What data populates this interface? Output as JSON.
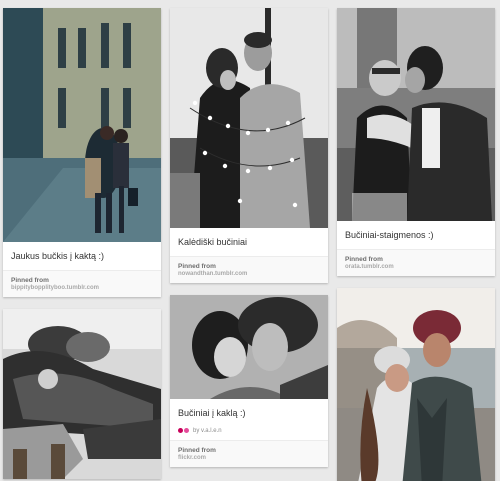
{
  "pins": {
    "p1": {
      "description": "Jaukus bučkis į kaktą :)",
      "pinned_label": "Pinned from",
      "source": "bippitybopplityboo.tumblr.com"
    },
    "p2": {
      "description": "",
      "pinned_label": "",
      "source": ""
    },
    "p3": {
      "description": "Kalėdiški bučiniai",
      "pinned_label": "Pinned from",
      "source": "nowandthan.tumblr.com"
    },
    "p4": {
      "description": "Bučiniai į kaklą :)",
      "via": "by v.a.l.e.n",
      "pinned_label": "Pinned from",
      "source": "flickr.com"
    },
    "p5": {
      "description": "Bučiniai-staigmenos :)",
      "pinned_label": "Pinned from",
      "source": "orata.tumblr.com"
    },
    "p6": {
      "description": "",
      "pinned_label": "",
      "source": ""
    }
  },
  "colors": {
    "background": "#e9e9e9",
    "card": "#ffffff",
    "source_text": "#a9a9a9"
  }
}
